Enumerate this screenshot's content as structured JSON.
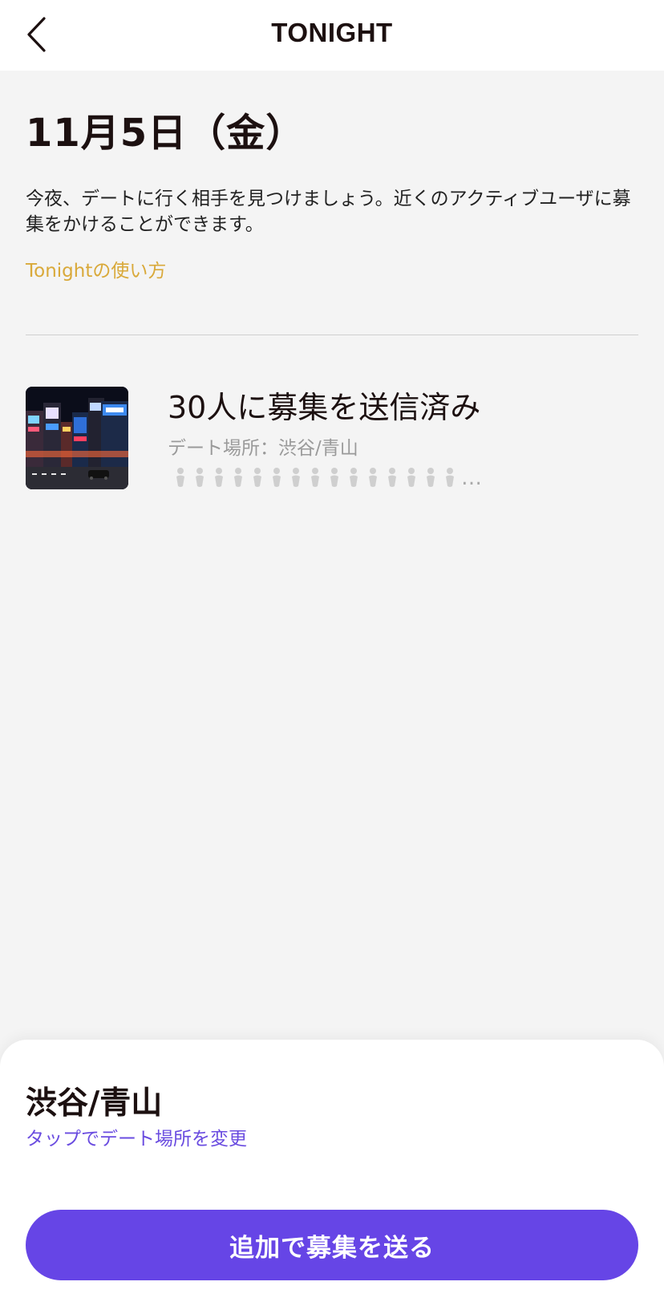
{
  "nav": {
    "title": "TONIGHT",
    "back_icon": "chevron-left-icon"
  },
  "header": {
    "date": "11月5日（金）",
    "description": "今夜、デートに行く相手を見つけましょう。近くのアクティブユーザに募集をかけることができます。",
    "howto_link": "Tonightの使い方"
  },
  "status": {
    "thumbnail_icon": "city-night-photo",
    "title": "30人に募集を送信済み",
    "place_line": "デート場所：渋谷/青山",
    "person_icon": "person-icon",
    "person_icon_count": 15,
    "more": "…"
  },
  "sheet": {
    "place": "渋谷/青山",
    "change_link": "タップでデート場所を変更",
    "cta": "追加で募集を送る"
  },
  "colors": {
    "accent_gold": "#d9a93a",
    "accent_purple": "#6645e6",
    "link_purple": "#6a4ce0",
    "background": "#f4f4f4"
  }
}
